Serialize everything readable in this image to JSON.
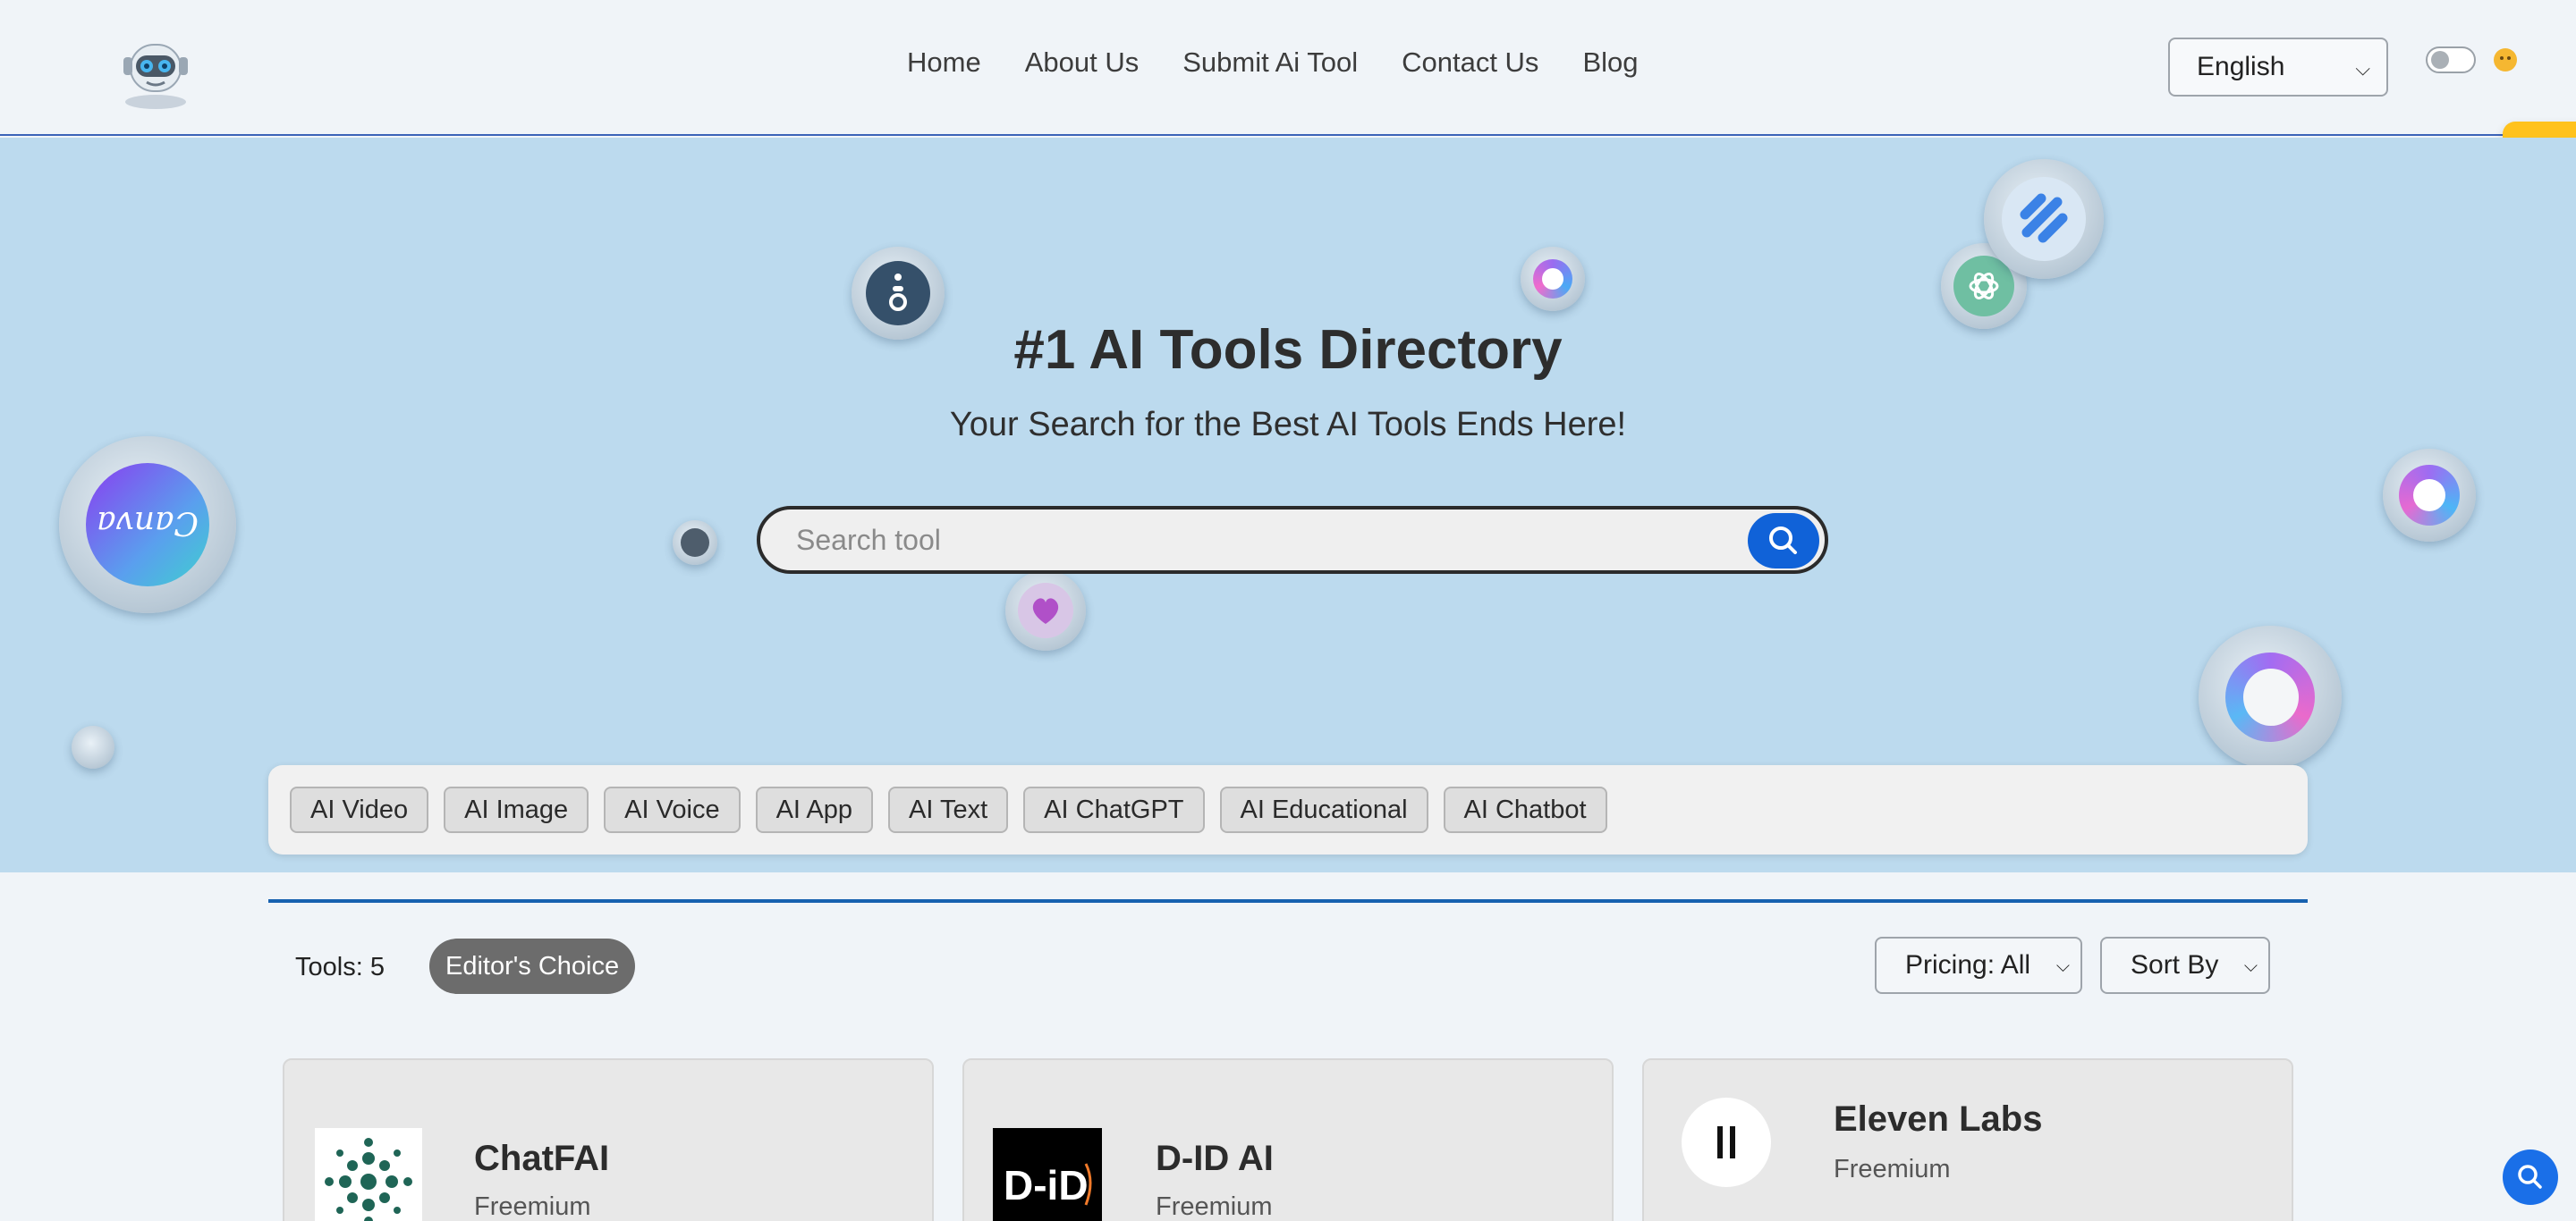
{
  "header": {
    "nav": [
      "Home",
      "About Us",
      "Submit Ai Tool",
      "Contact Us",
      "Blog"
    ],
    "language": "English"
  },
  "hero": {
    "title": "#1 AI Tools Directory",
    "subtitle": "Your Search for the Best AI Tools Ends Here!",
    "search_placeholder": "Search tool",
    "bubble_logos": [
      "tool-logo",
      "openai-logo",
      "canva-logo",
      "ai-tool-logo"
    ]
  },
  "categories": [
    "AI Video",
    "AI Image",
    "AI Voice",
    "AI App",
    "AI Text",
    "AI ChatGPT",
    "AI Educational",
    "AI Chatbot"
  ],
  "toolbar": {
    "tools_count": "Tools: 5",
    "editors_choice": "Editor's Choice",
    "pricing_filter": "Pricing: All",
    "sort_by": "Sort By"
  },
  "cards": [
    {
      "name": "ChatFAI",
      "pricing": "Freemium",
      "logo": "chatfai-logo"
    },
    {
      "name": "D-ID AI",
      "pricing": "Freemium",
      "logo": "did-logo"
    },
    {
      "name": "Eleven Labs",
      "pricing": "Freemium",
      "logo": "elevenlabs-logo"
    }
  ],
  "colors": {
    "accent": "#1062d8",
    "hero_bg": "#bcdaee",
    "page_bg": "#f0f4f8",
    "side_tab": "#ffc21d"
  }
}
